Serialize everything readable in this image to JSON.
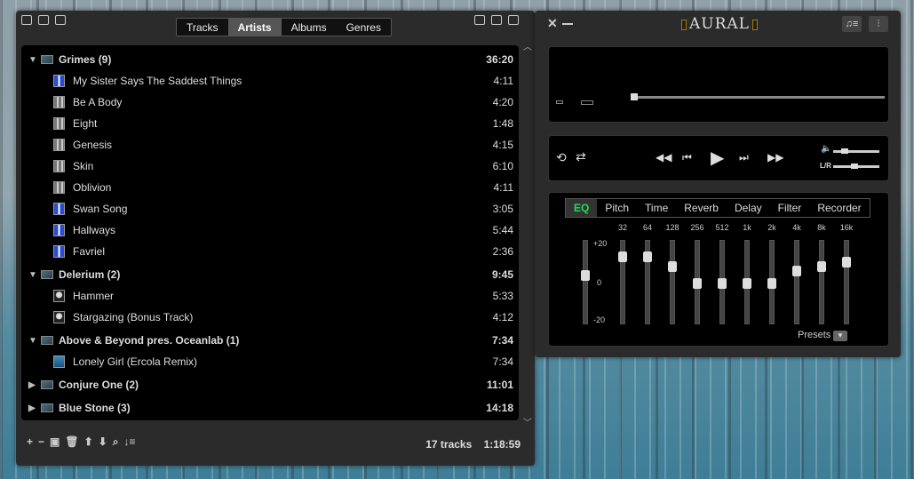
{
  "playlist": {
    "tabs": [
      "Tracks",
      "Artists",
      "Albums",
      "Genres"
    ],
    "active_tab": "Artists",
    "rows": [
      {
        "kind": "group",
        "label": "Grimes (9)",
        "duration": "36:20",
        "expanded": true
      },
      {
        "kind": "track",
        "label": "My Sister Says The Saddest Things",
        "duration": "4:11",
        "art": "blue"
      },
      {
        "kind": "track",
        "label": "Be A Body",
        "duration": "4:20",
        "art": "gray"
      },
      {
        "kind": "track",
        "label": "Eight",
        "duration": "1:48",
        "art": "gray"
      },
      {
        "kind": "track",
        "label": "Genesis",
        "duration": "4:15",
        "art": "gray"
      },
      {
        "kind": "track",
        "label": "Skin",
        "duration": "6:10",
        "art": "gray"
      },
      {
        "kind": "track",
        "label": "Oblivion",
        "duration": "4:11",
        "art": "gray"
      },
      {
        "kind": "track",
        "label": "Swan Song",
        "duration": "3:05",
        "art": "blue"
      },
      {
        "kind": "track",
        "label": "Hallways",
        "duration": "5:44",
        "art": "blue"
      },
      {
        "kind": "track",
        "label": "Favriel",
        "duration": "2:36",
        "art": "blue"
      },
      {
        "kind": "group",
        "label": "Delerium (2)",
        "duration": "9:45",
        "expanded": true
      },
      {
        "kind": "track",
        "label": "Hammer",
        "duration": "5:33",
        "art": "face"
      },
      {
        "kind": "track",
        "label": "Stargazing (Bonus Track)",
        "duration": "4:12",
        "art": "face"
      },
      {
        "kind": "group",
        "label": "Above & Beyond pres. Oceanlab (1)",
        "duration": "7:34",
        "expanded": true
      },
      {
        "kind": "track",
        "label": "Lonely Girl (Ercola Remix)",
        "duration": "7:34",
        "art": "sea"
      },
      {
        "kind": "group",
        "label": "Conjure One (2)",
        "duration": "11:01",
        "expanded": false
      },
      {
        "kind": "group",
        "label": "Blue Stone (3)",
        "duration": "14:18",
        "expanded": false
      }
    ],
    "summary": {
      "tracks": "17 tracks",
      "total": "1:18:59"
    }
  },
  "player": {
    "title": "AURAL",
    "eq": {
      "tabs": [
        "EQ",
        "Pitch",
        "Time",
        "Reverb",
        "Delay",
        "Filter",
        "Recorder"
      ],
      "active_tab": "EQ",
      "bands": [
        {
          "label": "32",
          "gain": 0.85
        },
        {
          "label": "64",
          "gain": 0.85
        },
        {
          "label": "128",
          "gain": 0.72
        },
        {
          "label": "256",
          "gain": 0.5
        },
        {
          "label": "512",
          "gain": 0.5
        },
        {
          "label": "1k",
          "gain": 0.5
        },
        {
          "label": "2k",
          "gain": 0.5
        },
        {
          "label": "4k",
          "gain": 0.66
        },
        {
          "label": "8k",
          "gain": 0.72
        },
        {
          "label": "16k",
          "gain": 0.78
        }
      ],
      "preamp": 0.6,
      "gain_labels": [
        "+20",
        "0",
        "-20"
      ],
      "presets_label": "Presets"
    },
    "volume_label": "",
    "balance_label": "L/R",
    "seek": 0.0,
    "volume": 0.2,
    "balance": 0.45
  }
}
